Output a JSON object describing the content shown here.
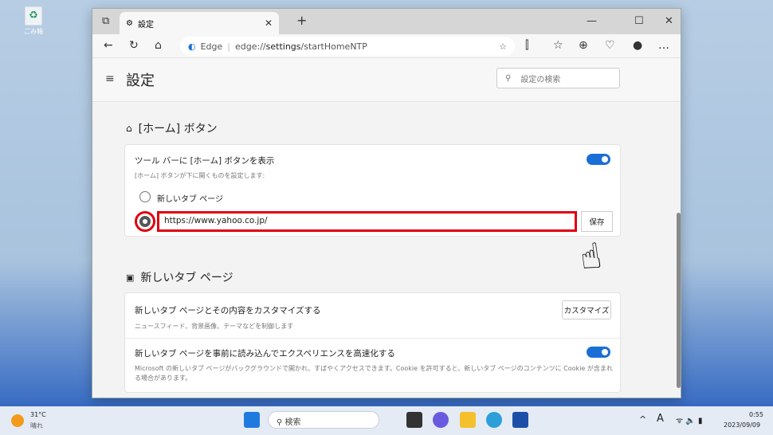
{
  "desktop": {
    "recycle_bin_label": "ごみ箱"
  },
  "browser": {
    "tab_title": "設定",
    "url_brand": "Edge",
    "url_prefix": "edge://",
    "url_bold": "settings",
    "url_suffix": "/startHomeNTP"
  },
  "settings": {
    "title": "設定",
    "search_placeholder": "設定の検索",
    "home_section": {
      "heading": "[ホーム] ボタン",
      "toggle_label": "ツール バーに [ホーム] ボタンを表示",
      "toggle_on": true,
      "description": "[ホーム] ボタンが下に開くものを設定します:",
      "option_new_tab": "新しいタブ ページ",
      "url_value": "https://www.yahoo.co.jp/",
      "selected": "url",
      "save_label": "保存"
    },
    "ntp_section": {
      "heading": "新しいタブ ページ",
      "customize_title": "新しいタブ ページとその内容をカスタマイズする",
      "customize_desc": "ニュースフィード、背景画像、テーマなどを制御します",
      "customize_button": "カスタマイズ",
      "preload_title": "新しいタブ ページを事前に読み込んでエクスペリエンスを高速化する",
      "preload_desc": "Microsoft の新しいタブ ページがバックグラウンドで開かれ、すばやくアクセスできます。Cookie を許可すると、新しいタブ ページのコンテンツに Cookie が含まれる場合があります。",
      "preload_on": true
    }
  },
  "taskbar": {
    "temperature": "31°C",
    "weather": "晴れ",
    "search_label": "検索",
    "time": "0:55",
    "date": "2023/09/09",
    "ime": "A"
  },
  "colors": {
    "accent": "#1a6fd6",
    "highlight": "#e00010"
  }
}
